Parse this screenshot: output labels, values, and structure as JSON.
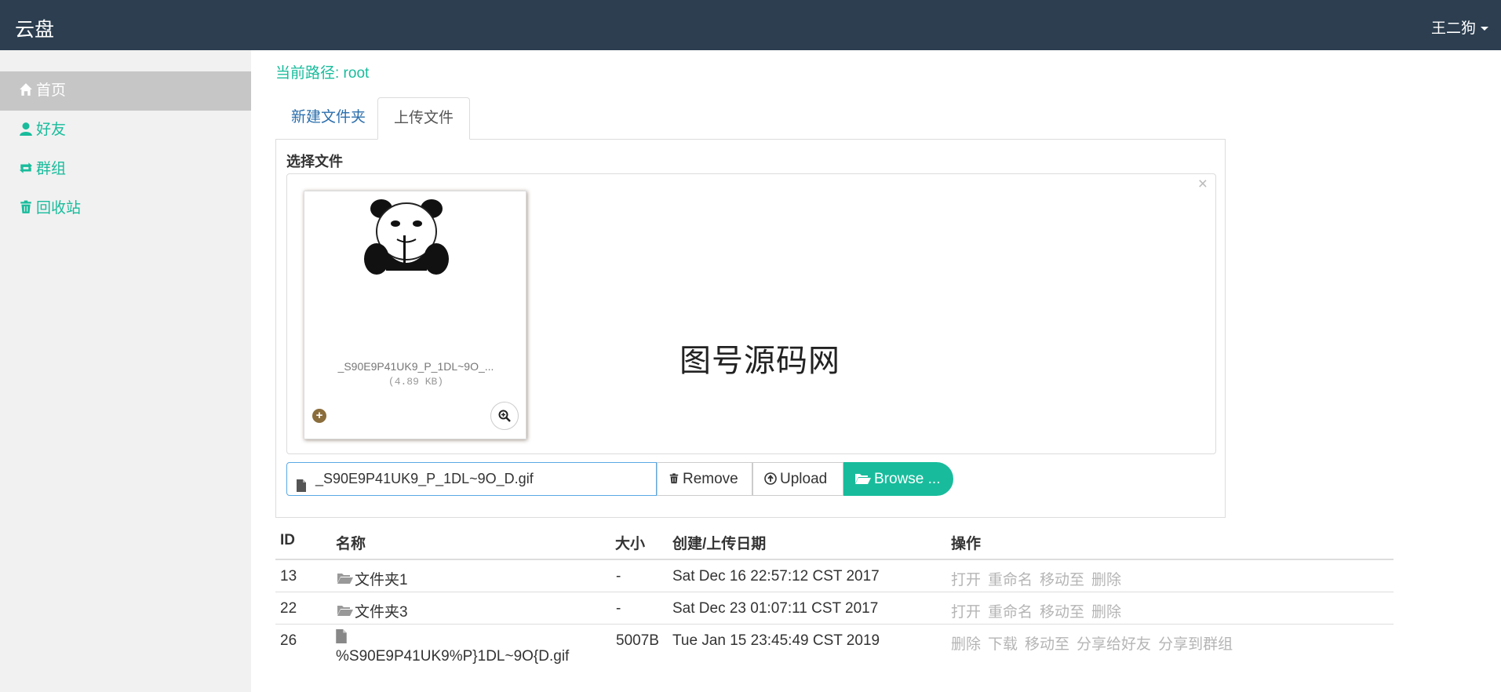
{
  "navbar": {
    "brand": "云盘",
    "user": "王二狗"
  },
  "sidebar": {
    "items": [
      {
        "label": "首页",
        "icon": "home-icon",
        "active": true
      },
      {
        "label": "好友",
        "icon": "user-icon",
        "active": false
      },
      {
        "label": "群组",
        "icon": "retweet-icon",
        "active": false
      },
      {
        "label": "回收站",
        "icon": "trash-icon",
        "active": false
      }
    ]
  },
  "path": {
    "text": "当前路径: root"
  },
  "tabs": [
    {
      "label": "新建文件夹",
      "active": false
    },
    {
      "label": "上传文件",
      "active": true
    }
  ],
  "upload": {
    "choose_label": "选择文件",
    "preview": {
      "file_name": "_S90E9P41UK9_P_1DL~9O_...",
      "file_size": "(4.89 KB)"
    },
    "watermark": "图号源码网",
    "file_input_value": "_S90E9P41UK9_P_1DL~9O_D.gif",
    "remove_label": "Remove",
    "upload_label": "Upload",
    "browse_label": "Browse ..."
  },
  "table": {
    "headers": {
      "id": "ID",
      "name": "名称",
      "size": "大小",
      "date": "创建/上传日期",
      "ops": "操作"
    },
    "rows": [
      {
        "id": "13",
        "name": "文件夹1",
        "type": "folder",
        "size": "-",
        "date": "Sat Dec 16 22:57:12 CST 2017",
        "ops": [
          "打开",
          "重命名",
          "移动至",
          "删除"
        ]
      },
      {
        "id": "22",
        "name": "文件夹3",
        "type": "folder",
        "size": "-",
        "date": "Sat Dec 23 01:07:11 CST 2017",
        "ops": [
          "打开",
          "重命名",
          "移动至",
          "删除"
        ]
      },
      {
        "id": "26",
        "name": "%S90E9P41UK9%P}1DL~9O{D.gif",
        "type": "file",
        "size": "5007B",
        "date": "Tue Jan 15 23:45:49 CST 2019",
        "ops": [
          "删除",
          "下载",
          "移动至",
          "分享给好友",
          "分享到群组"
        ]
      }
    ]
  },
  "colors": {
    "navbar": "#2c3e50",
    "accent": "#18bc9c",
    "link": "#2c6fad",
    "muted": "#b5b5b5"
  }
}
